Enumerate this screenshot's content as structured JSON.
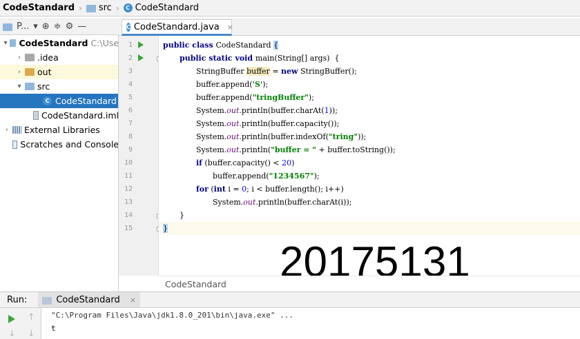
{
  "breadcrumb": {
    "project": "CodeStandard",
    "folder": "src",
    "file": "CodeStandard"
  },
  "project_panel": {
    "title": "P...",
    "tree": [
      {
        "label": "CodeStandard",
        "detail": "C:\\Use",
        "icon": "folder-icon",
        "bold": true,
        "expanded": true
      },
      {
        "label": ".idea",
        "icon": "folder-icon"
      },
      {
        "label": "out",
        "icon": "folder-icon",
        "highlight": true
      },
      {
        "label": "src",
        "icon": "folder-icon",
        "expanded": true
      },
      {
        "label": "CodeStandard",
        "icon": "java-class-icon",
        "selected": true
      },
      {
        "label": "CodeStandard.iml",
        "icon": "module-file-icon"
      },
      {
        "label": "External Libraries",
        "icon": "library-icon"
      },
      {
        "label": "Scratches and Console",
        "icon": "scratch-icon"
      }
    ]
  },
  "editor": {
    "tab_label": "CodeStandard.java",
    "footer_label": "CodeStandard",
    "line_numbers": [
      "1",
      "2",
      "3",
      "4",
      "5",
      "6",
      "7",
      "8",
      "9",
      "10",
      "11",
      "12",
      "13",
      "14",
      "15"
    ],
    "code": {
      "l1_kw": "public class ",
      "l1_name": "CodeStandard ",
      "l1_brace": "{",
      "l2_kw": "public static void ",
      "l2_rest": "main(String[] args)  {",
      "l3_a": "StringBuffer ",
      "l3_var": "buffer",
      "l3_b": " = ",
      "l3_kw": "new",
      "l3_c": " StringBuffer();",
      "l4_a": "buffer.append(",
      "l4_str": "'S'",
      "l4_b": ");",
      "l5_a": "buffer.append(",
      "l5_str": "\"tringBuffer\"",
      "l5_b": ");",
      "l6_a": "System.",
      "l6_fld": "out",
      "l6_b": ".println(buffer.charAt(",
      "l6_num": "1",
      "l6_c": "));",
      "l7_a": "System.",
      "l7_fld": "out",
      "l7_b": ".println(buffer.capacity());",
      "l8_a": "System.",
      "l8_fld": "out",
      "l8_b": ".println(buffer.indexOf(",
      "l8_str": "\"tring\"",
      "l8_c": "));",
      "l9_a": "System.",
      "l9_fld": "out",
      "l9_b": ".println(",
      "l9_str": "\"buffer = \"",
      "l9_c": " + buffer.toString());",
      "l10_kw": "if",
      "l10_a": " (buffer.capacity() < ",
      "l10_num": "20",
      "l10_b": ")",
      "l11_a": "buffer.append(",
      "l11_str": "\"1234567\"",
      "l11_b": ");",
      "l12_kw": "for",
      "l12_a": " (",
      "l12_kw2": "int",
      "l12_b": " i = ",
      "l12_num": "0",
      "l12_c": "; i < buffer.length(); i++)",
      "l13_a": "System.",
      "l13_fld": "out",
      "l13_b": ".println(buffer.charAt(i));",
      "l14": "}",
      "l15": "}"
    }
  },
  "overlay_text": "20175131",
  "run_panel": {
    "label": "Run:",
    "tab_label": "CodeStandard",
    "console_lines": [
      "\"C:\\Program Files\\Java\\jdk1.8.0_201\\bin\\java.exe\" ...",
      "t"
    ]
  },
  "colors": {
    "selection": "#2675bf",
    "keyword": "#000080",
    "string": "#008000",
    "number": "#0000ff",
    "field": "#660e7a",
    "run_green": "#3ca43c"
  }
}
